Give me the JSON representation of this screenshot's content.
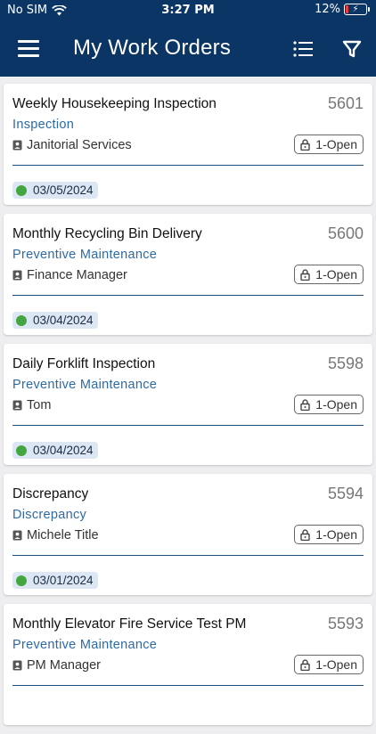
{
  "status_bar": {
    "carrier": "No SIM",
    "time": "3:27 PM",
    "battery": "12%",
    "battery_level": 0.12
  },
  "header": {
    "title": "My Work Orders"
  },
  "colors": {
    "header_bg": "#0a3565",
    "type_text": "#2e6aa6",
    "date_dot": "#44a640",
    "date_bg": "#dde7f3"
  },
  "work_orders": [
    {
      "title": "Weekly Housekeeping Inspection",
      "id": "5601",
      "type": "Inspection",
      "assignee": "Janitorial Services",
      "status": "1-Open",
      "date": "03/05/2024"
    },
    {
      "title": "Monthly Recycling Bin Delivery",
      "id": "5600",
      "type": "Preventive Maintenance",
      "assignee": "Finance Manager",
      "status": "1-Open",
      "date": "03/04/2024"
    },
    {
      "title": "Daily Forklift Inspection",
      "id": "5598",
      "type": "Preventive Maintenance",
      "assignee": "Tom",
      "status": "1-Open",
      "date": "03/04/2024"
    },
    {
      "title": "Discrepancy",
      "id": "5594",
      "type": "Discrepancy",
      "assignee": "Michele Title",
      "status": "1-Open",
      "date": "03/01/2024"
    },
    {
      "title": "Monthly Elevator Fire Service Test PM",
      "id": "5593",
      "type": "Preventive Maintenance",
      "assignee": "PM Manager",
      "status": "1-Open",
      "date": ""
    }
  ]
}
